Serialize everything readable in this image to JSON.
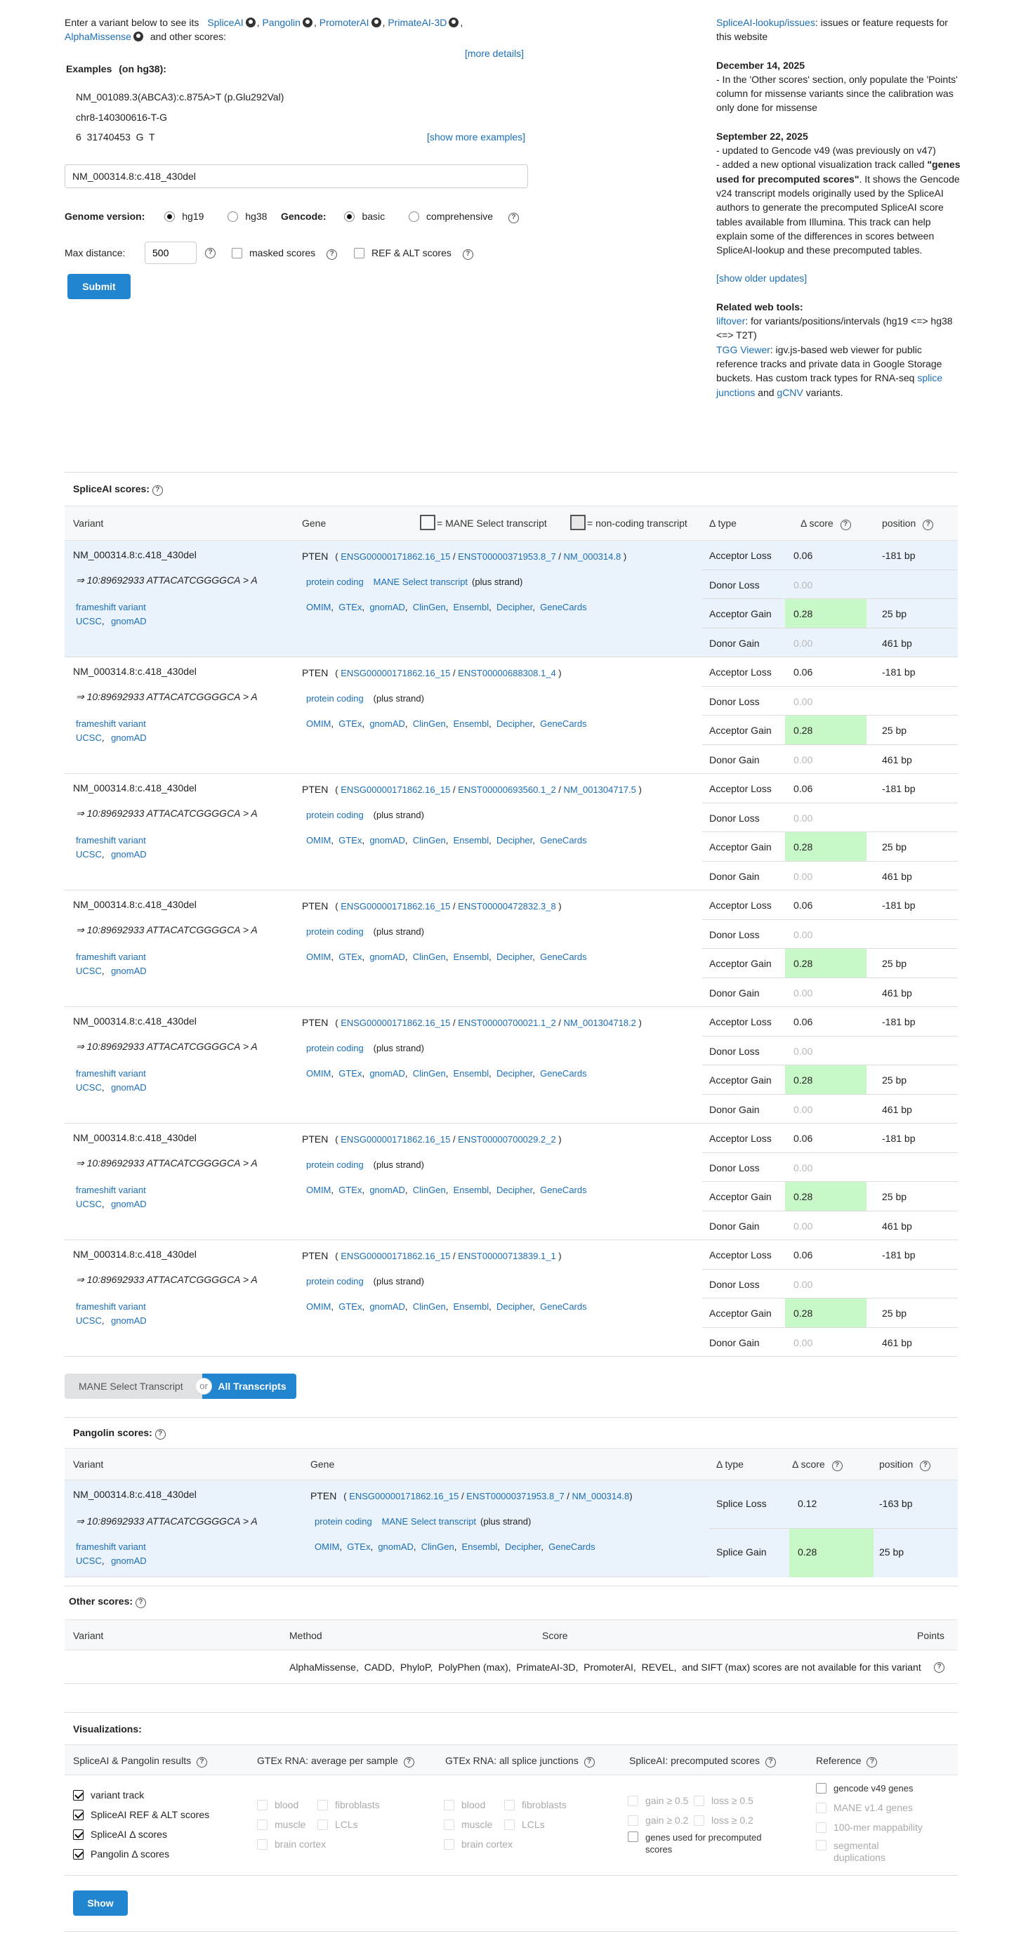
{
  "intro": {
    "prefix": "Enter a variant below to see its",
    "tools": [
      "SpliceAI",
      "Pangolin",
      "PromoterAI",
      "PrimateAI-3D",
      "AlphaMissense"
    ],
    "suffix": "and other scores:",
    "more_details": "[more details]"
  },
  "examples": {
    "title": "Examples",
    "genome": "(on hg38):",
    "items": [
      "NM_001089.3(ABCA3):c.875A>T (p.Glu292Val)",
      "chr8-140300616-T-G",
      "6  31740453  G  T"
    ],
    "show_more": "[show more examples]"
  },
  "variant_input": {
    "value": "NM_000314.8:c.418_430del"
  },
  "genome_version": {
    "label": "Genome version:",
    "options": [
      "hg19",
      "hg38"
    ],
    "selected": "hg19"
  },
  "gencode": {
    "label": "Gencode:",
    "options": [
      "basic",
      "comprehensive"
    ],
    "selected": "basic"
  },
  "max_distance": {
    "label": "Max distance:",
    "value": "500"
  },
  "checkbox_labels": {
    "masked": "masked scores",
    "refalt": "REF & ALT scores"
  },
  "submit_label": "Submit",
  "right_panel": {
    "issues_link": "SpliceAI-lookup/issues",
    "issues_text": ": issues or feature requests for this website",
    "updates": [
      {
        "date": "December 14, 2025",
        "lines": [
          "- In the 'Other scores' section, only populate the 'Points' column for missense variants since the calibration was only done for missense"
        ]
      },
      {
        "date": "September 22, 2025",
        "line1": "- updated to Gencode v49 (was previously on v47)",
        "line2_prefix": "- added a new optional visualization track called",
        "line2_bold": "\"genes used for precomputed scores\"",
        "line2_suffix": ". It shows the Gencode v24 transcript models originally used by the SpliceAI authors to generate the precomputed SpliceAI score tables available from Illumina. This track can help explain some of the differences in scores between SpliceAI-lookup and these precomputed tables."
      }
    ],
    "show_older": "[show older updates]",
    "related_title": "Related web tools:",
    "liftover_link": "liftover",
    "liftover_text": ": for variants/positions/intervals (hg19 <=> hg38 <=> T2T)",
    "tgg_link": "TGG Viewer",
    "tgg_text": ": igv.js-based web viewer for public reference tracks and private data in Google Storage buckets. Has custom track types for RNA-seq",
    "splice_link": "splice junctions",
    "and_text": "and",
    "gcnv_link": "gCNV",
    "variants_text": "variants."
  },
  "spliceai": {
    "title": "SpliceAI scores:",
    "headers": {
      "variant": "Variant",
      "gene": "Gene",
      "mane": "= MANE Select transcript",
      "noncoding": "= non-coding transcript",
      "dtype": "Δ type",
      "dscore": "Δ score",
      "position": "position"
    },
    "variant_name": "NM_000314.8:c.418_430del",
    "variant_coord": "⇒ 10:89692933 ATTACATCGGGGCA > A",
    "consequence": "frameshift variant",
    "links_left": [
      "UCSC",
      "gnomAD"
    ],
    "gene_symbol": "PTEN",
    "gene_id": "ENSG00000171862.16_15",
    "biotype": "protein coding",
    "mane_label": "MANE Select transcript",
    "strand": "(plus strand)",
    "db_links": [
      "OMIM",
      "GTEx",
      "gnomAD",
      "ClinGen",
      "Ensembl",
      "Decipher",
      "GeneCards"
    ],
    "transcripts": [
      {
        "enst": "ENST00000371953.8_7",
        "nm": "NM_000314.8",
        "mane": true
      },
      {
        "enst": "ENST00000688308.1_4",
        "nm": "",
        "mane": false
      },
      {
        "enst": "ENST00000693560.1_2",
        "nm": "NM_001304717.5",
        "mane": false
      },
      {
        "enst": "ENST00000472832.3_8",
        "nm": "",
        "mane": false
      },
      {
        "enst": "ENST00000700021.1_2",
        "nm": "NM_001304718.2",
        "mane": false
      },
      {
        "enst": "ENST00000700029.2_2",
        "nm": "",
        "mane": false
      },
      {
        "enst": "ENST00000713839.1_1",
        "nm": "",
        "mane": false
      }
    ],
    "deltas": [
      {
        "type": "Acceptor Loss",
        "score": "0.06",
        "pos": "-181 bp",
        "hi": false,
        "dim": false
      },
      {
        "type": "Donor Loss",
        "score": "0.00",
        "pos": "",
        "hi": false,
        "dim": true
      },
      {
        "type": "Acceptor Gain",
        "score": "0.28",
        "pos": "25 bp",
        "hi": true,
        "dim": false
      },
      {
        "type": "Donor Gain",
        "score": "0.00",
        "pos": "461 bp",
        "hi": false,
        "dim": true
      }
    ]
  },
  "toggle": {
    "left": "MANE Select Transcript",
    "or": "or",
    "right": "All Transcripts"
  },
  "pangolin": {
    "title": "Pangolin scores:",
    "headers": {
      "variant": "Variant",
      "gene": "Gene",
      "dtype": "Δ type",
      "dscore": "Δ score",
      "position": "position"
    },
    "deltas": [
      {
        "type": "Splice Loss",
        "score": "0.12",
        "pos": "-163 bp",
        "hi": false
      },
      {
        "type": "Splice Gain",
        "score": "0.28",
        "pos": "25 bp",
        "hi": true
      }
    ]
  },
  "other": {
    "title": "Other scores:",
    "headers": {
      "variant": "Variant",
      "method": "Method",
      "score": "Score",
      "points": "Points"
    },
    "message": "AlphaMissense,  CADD,  PhyloP,  PolyPhen (max),  PrimateAI-3D,  PromoterAI,  REVEL,  and SIFT (max) scores are not available for this variant"
  },
  "vis": {
    "title": "Visualizations:",
    "cols": [
      "SpliceAI & Pangolin results",
      "GTEx RNA: average per sample",
      "GTEx RNA: all splice junctions",
      "SpliceAI: precomputed scores",
      "Reference"
    ],
    "c1": [
      "variant track",
      "SpliceAI REF & ALT scores",
      "SpliceAI Δ scores",
      "Pangolin Δ scores"
    ],
    "gtex": [
      "blood",
      "fibroblasts",
      "muscle",
      "LCLs",
      "brain cortex"
    ],
    "pre": [
      "gain ≥ 0.5",
      "loss ≥ 0.5",
      "gain ≥ 0.2",
      "loss ≥ 0.2",
      "genes used for precomputed scores"
    ],
    "ref": [
      "gencode v49 genes",
      "MANE v1.4 genes",
      "100-mer mappability",
      "segmental duplications"
    ],
    "show": "Show"
  }
}
